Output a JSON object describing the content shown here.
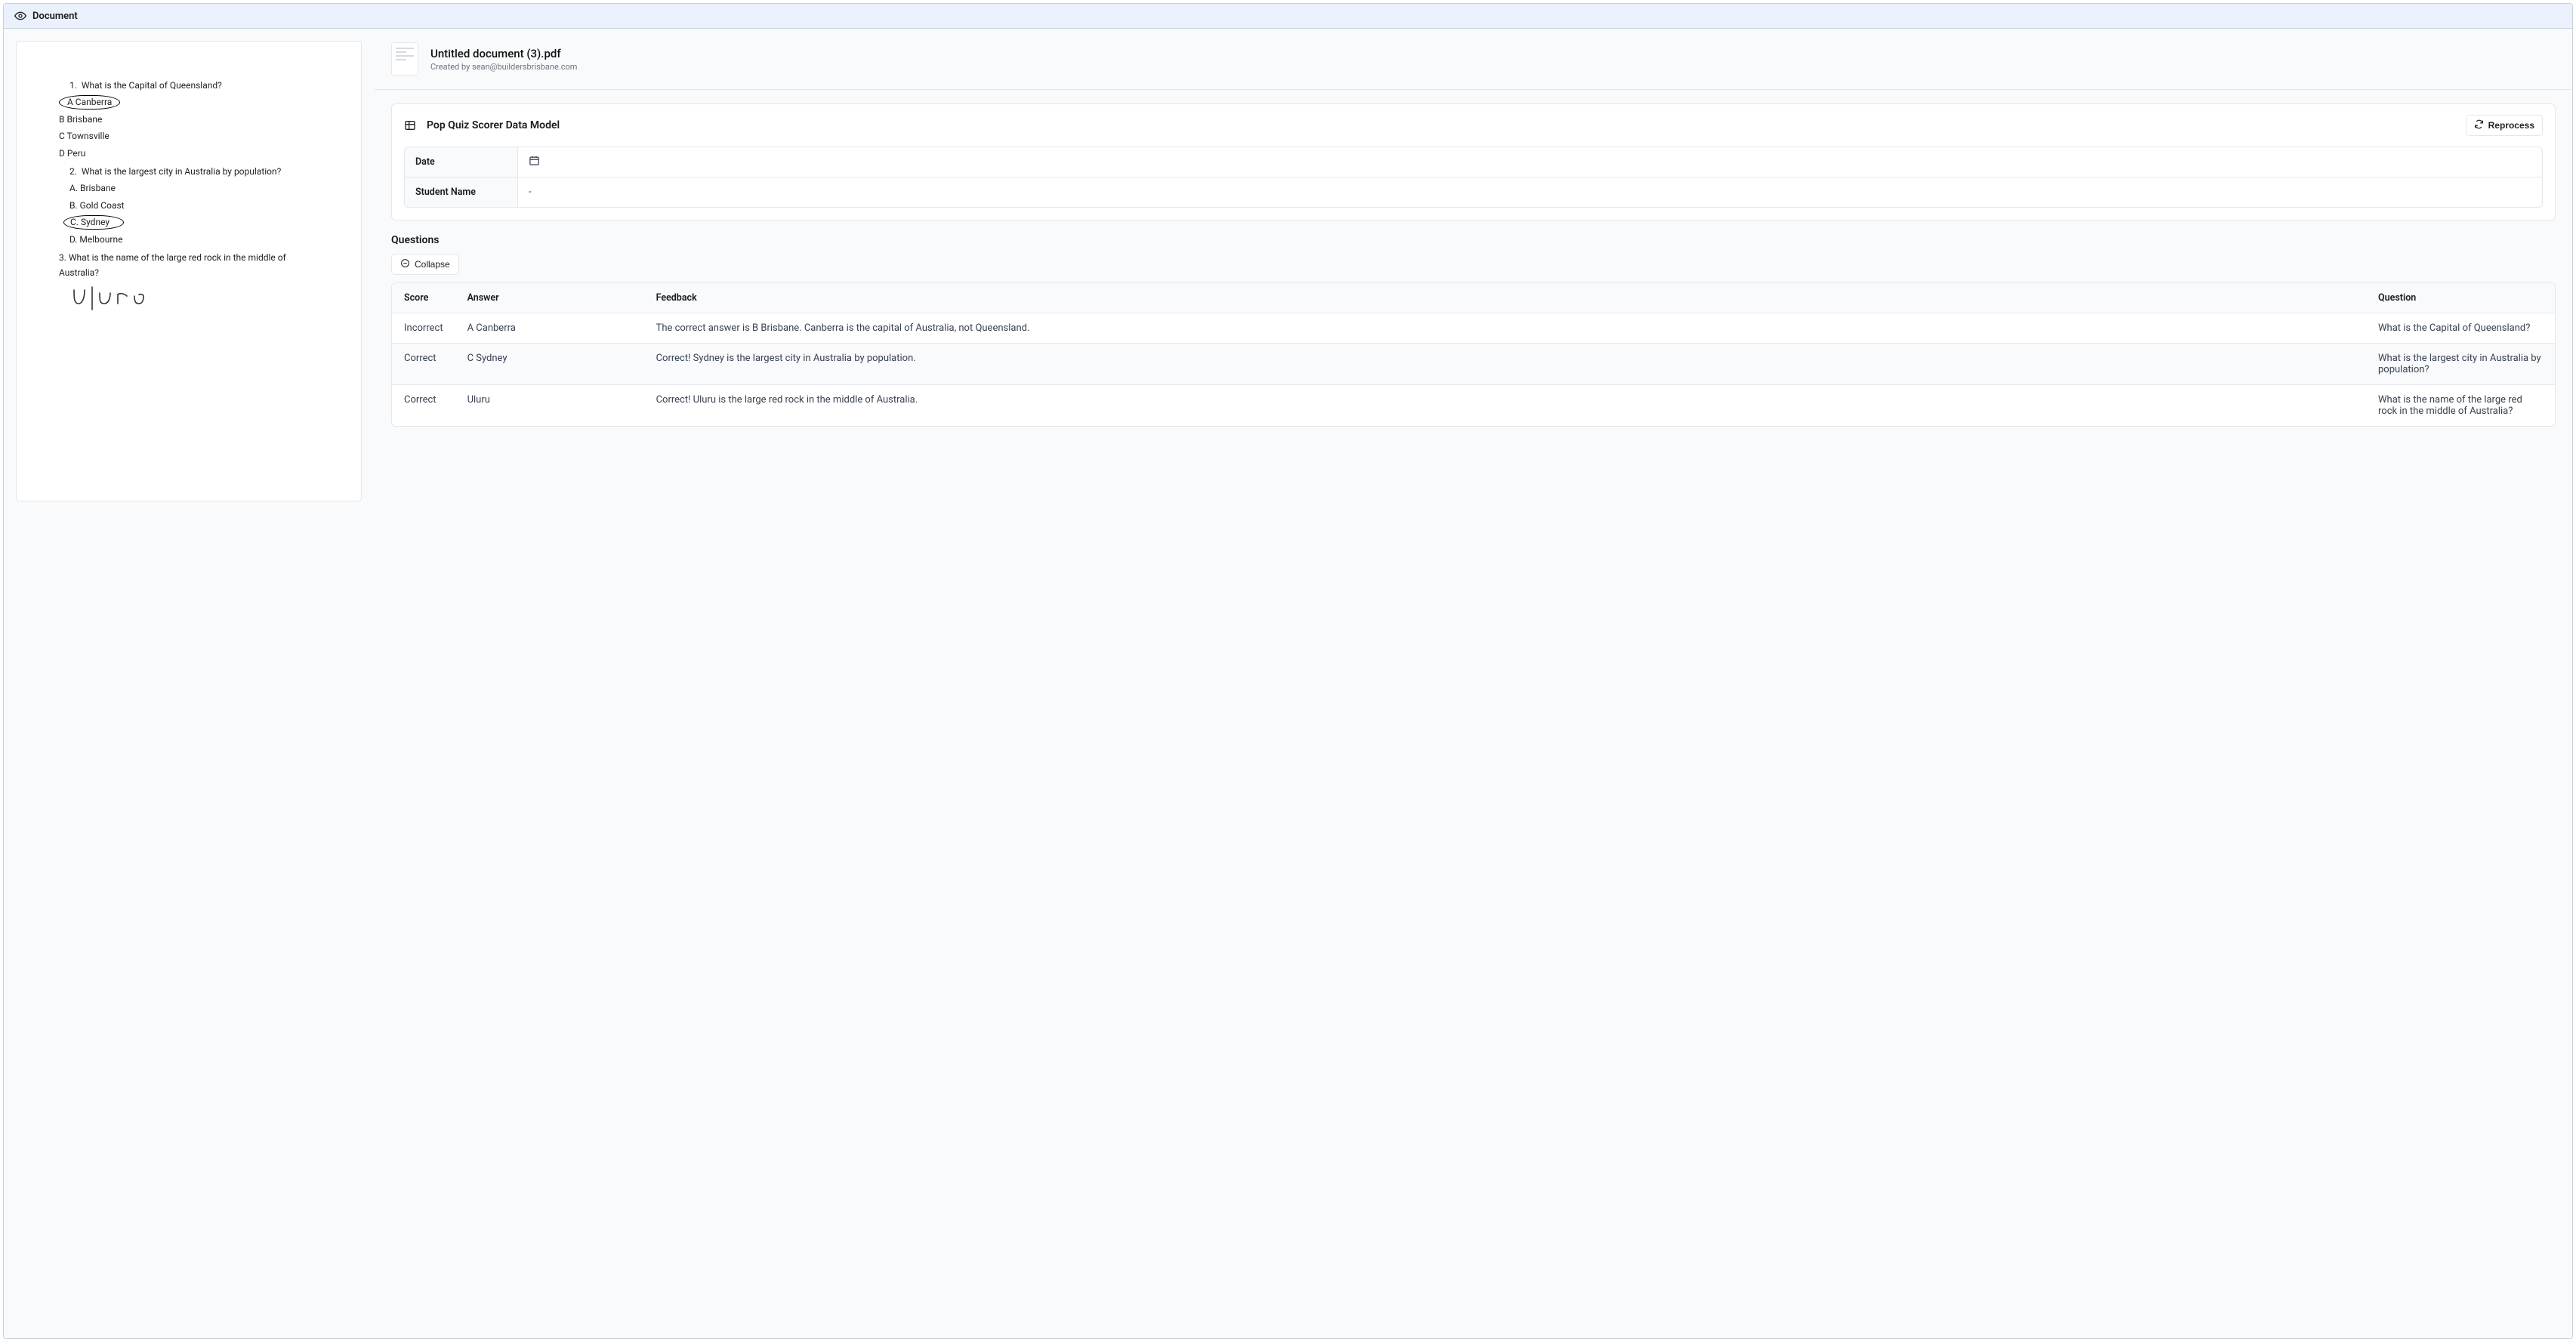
{
  "header": {
    "title": "Document"
  },
  "doc": {
    "q1": {
      "num": "1.",
      "text": "What is the Capital of Queensland?",
      "a": "A Canberra",
      "b": "B Brisbane",
      "c": "C Townsville",
      "d": "D Peru"
    },
    "q2": {
      "num": "2.",
      "text": "What is the largest city in Australia by population?",
      "a": "A.   Brisbane",
      "b": "B.   Gold Coast",
      "c": "C.   Sydney",
      "d": "D.   Melbourne"
    },
    "q3": {
      "num": "3.",
      "text": "What is the name of the large red rock in the middle of Australia?"
    }
  },
  "file": {
    "title": "Untitled document (3).pdf",
    "createdBy": "Created by sean@buildersbrisbane.com"
  },
  "model": {
    "name": "Pop Quiz Scorer Data Model",
    "reprocessLabel": "Reprocess",
    "fields": {
      "dateLabel": "Date",
      "dateValue": "",
      "studentLabel": "Student Name",
      "studentValue": "-"
    }
  },
  "questions": {
    "title": "Questions",
    "collapseLabel": "Collapse",
    "headers": {
      "score": "Score",
      "answer": "Answer",
      "feedback": "Feedback",
      "question": "Question"
    },
    "rows": [
      {
        "score": "Incorrect",
        "answer": "A Canberra",
        "feedback": "The correct answer is B Brisbane. Canberra is the capital of Australia, not Queensland.",
        "question": "What is the Capital of Queensland?"
      },
      {
        "score": "Correct",
        "answer": "C Sydney",
        "feedback": "Correct! Sydney is the largest city in Australia by population.",
        "question": "What is the largest city in Australia by population?"
      },
      {
        "score": "Correct",
        "answer": "Uluru",
        "feedback": "Correct! Uluru is the large red rock in the middle of Australia.",
        "question": "What is the name of the large red rock in the middle of Australia?"
      }
    ]
  }
}
